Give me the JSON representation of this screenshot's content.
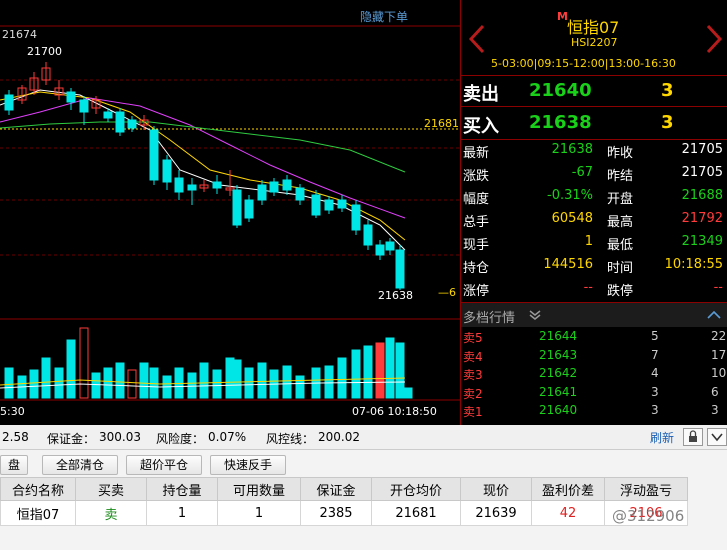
{
  "chart": {
    "hide_orders": "隐藏下单",
    "price_top": "21674",
    "high_label": "21700",
    "line_label": "21681",
    "last_label": "21638",
    "hint_label": "—6",
    "time_left": "5:30",
    "time_right": "07-06 10:18:50"
  },
  "chart_data": {
    "type": "candlestick",
    "last_price": 21638,
    "reference_line": 21681,
    "ma_series": [
      "white",
      "yellow",
      "magenta",
      "green"
    ],
    "colors": {
      "up": "#ff3b3b",
      "down": "#00e5e5",
      "background": "#000000"
    }
  },
  "quote": {
    "badge": "M",
    "name": "恒指07",
    "code": "HSI2207",
    "session": "5-03:00|09:15-12:00|13:00-16:30",
    "sell_label": "卖出",
    "sell_price": "21640",
    "sell_qty": "3",
    "buy_label": "买入",
    "buy_price": "21638",
    "buy_qty": "3",
    "stats": [
      {
        "l1": "最新",
        "v1": "21638",
        "c1": "green",
        "l2": "昨收",
        "v2": "21705",
        "c2": "white"
      },
      {
        "l1": "涨跌",
        "v1": "-67",
        "c1": "green",
        "l2": "昨结",
        "v2": "21705",
        "c2": "white"
      },
      {
        "l1": "幅度",
        "v1": "-0.31%",
        "c1": "green",
        "l2": "开盘",
        "v2": "21688",
        "c2": "green"
      },
      {
        "l1": "总手",
        "v1": "60548",
        "c1": "yellow",
        "l2": "最高",
        "v2": "21792",
        "c2": "red"
      },
      {
        "l1": "现手",
        "v1": "1",
        "c1": "yellow",
        "l2": "最低",
        "v2": "21349",
        "c2": "green"
      },
      {
        "l1": "持仓",
        "v1": "144516",
        "c1": "yellow",
        "l2": "时间",
        "v2": "10:18:55",
        "c2": "yellow"
      },
      {
        "l1": "涨停",
        "v1": "--",
        "c1": "red",
        "l2": "跌停",
        "v2": "--",
        "c2": "red"
      }
    ],
    "depth_title": "多档行情",
    "depth": [
      {
        "label": "卖5",
        "price": "21644",
        "qty": "5",
        "extra": "22"
      },
      {
        "label": "卖4",
        "price": "21643",
        "qty": "7",
        "extra": "17"
      },
      {
        "label": "卖3",
        "price": "21642",
        "qty": "4",
        "extra": "10"
      },
      {
        "label": "卖2",
        "price": "21641",
        "qty": "3",
        "extra": "6"
      },
      {
        "label": "卖1",
        "price": "21640",
        "qty": "3",
        "extra": "3"
      }
    ]
  },
  "account": {
    "funds": "2.58",
    "margin_label": "保证金：",
    "margin": "300.03",
    "risk_label": "风险度：",
    "risk": "0.07%",
    "control_label": "风控线：",
    "control": "200.02",
    "refresh": "刷新"
  },
  "buttons": {
    "tab": "盘",
    "close_all": "全部清仓",
    "close_at_market": "超价平仓",
    "quick_reverse": "快速反手"
  },
  "positions": {
    "headers": [
      "合约名称",
      "买卖",
      "持仓量",
      "可用数量",
      "保证金",
      "开仓均价",
      "现价",
      "盈利价差",
      "浮动盈亏"
    ],
    "rows": [
      {
        "name": "恒指07",
        "side": "卖",
        "qty": "1",
        "available": "1",
        "margin": "2385",
        "open_avg": "21681",
        "current": "21639",
        "diff": "42",
        "pnl": "2106"
      }
    ]
  },
  "watermark": "@312906"
}
